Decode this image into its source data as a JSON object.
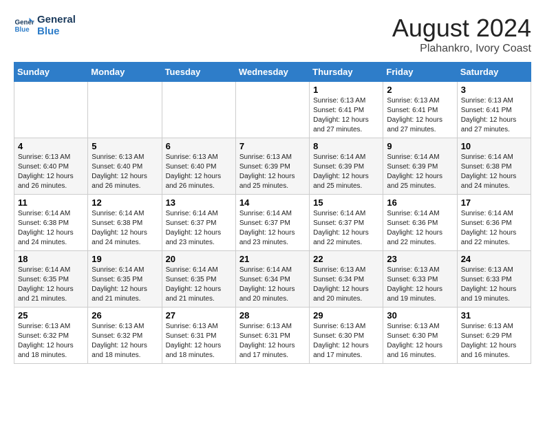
{
  "logo": {
    "line1": "General",
    "line2": "Blue"
  },
  "title": "August 2024",
  "subtitle": "Plahankro, Ivory Coast",
  "days_of_week": [
    "Sunday",
    "Monday",
    "Tuesday",
    "Wednesday",
    "Thursday",
    "Friday",
    "Saturday"
  ],
  "weeks": [
    [
      {
        "day": "",
        "info": ""
      },
      {
        "day": "",
        "info": ""
      },
      {
        "day": "",
        "info": ""
      },
      {
        "day": "",
        "info": ""
      },
      {
        "day": "1",
        "info": "Sunrise: 6:13 AM\nSunset: 6:41 PM\nDaylight: 12 hours\nand 27 minutes."
      },
      {
        "day": "2",
        "info": "Sunrise: 6:13 AM\nSunset: 6:41 PM\nDaylight: 12 hours\nand 27 minutes."
      },
      {
        "day": "3",
        "info": "Sunrise: 6:13 AM\nSunset: 6:41 PM\nDaylight: 12 hours\nand 27 minutes."
      }
    ],
    [
      {
        "day": "4",
        "info": "Sunrise: 6:13 AM\nSunset: 6:40 PM\nDaylight: 12 hours\nand 26 minutes."
      },
      {
        "day": "5",
        "info": "Sunrise: 6:13 AM\nSunset: 6:40 PM\nDaylight: 12 hours\nand 26 minutes."
      },
      {
        "day": "6",
        "info": "Sunrise: 6:13 AM\nSunset: 6:40 PM\nDaylight: 12 hours\nand 26 minutes."
      },
      {
        "day": "7",
        "info": "Sunrise: 6:13 AM\nSunset: 6:39 PM\nDaylight: 12 hours\nand 25 minutes."
      },
      {
        "day": "8",
        "info": "Sunrise: 6:14 AM\nSunset: 6:39 PM\nDaylight: 12 hours\nand 25 minutes."
      },
      {
        "day": "9",
        "info": "Sunrise: 6:14 AM\nSunset: 6:39 PM\nDaylight: 12 hours\nand 25 minutes."
      },
      {
        "day": "10",
        "info": "Sunrise: 6:14 AM\nSunset: 6:38 PM\nDaylight: 12 hours\nand 24 minutes."
      }
    ],
    [
      {
        "day": "11",
        "info": "Sunrise: 6:14 AM\nSunset: 6:38 PM\nDaylight: 12 hours\nand 24 minutes."
      },
      {
        "day": "12",
        "info": "Sunrise: 6:14 AM\nSunset: 6:38 PM\nDaylight: 12 hours\nand 24 minutes."
      },
      {
        "day": "13",
        "info": "Sunrise: 6:14 AM\nSunset: 6:37 PM\nDaylight: 12 hours\nand 23 minutes."
      },
      {
        "day": "14",
        "info": "Sunrise: 6:14 AM\nSunset: 6:37 PM\nDaylight: 12 hours\nand 23 minutes."
      },
      {
        "day": "15",
        "info": "Sunrise: 6:14 AM\nSunset: 6:37 PM\nDaylight: 12 hours\nand 22 minutes."
      },
      {
        "day": "16",
        "info": "Sunrise: 6:14 AM\nSunset: 6:36 PM\nDaylight: 12 hours\nand 22 minutes."
      },
      {
        "day": "17",
        "info": "Sunrise: 6:14 AM\nSunset: 6:36 PM\nDaylight: 12 hours\nand 22 minutes."
      }
    ],
    [
      {
        "day": "18",
        "info": "Sunrise: 6:14 AM\nSunset: 6:35 PM\nDaylight: 12 hours\nand 21 minutes."
      },
      {
        "day": "19",
        "info": "Sunrise: 6:14 AM\nSunset: 6:35 PM\nDaylight: 12 hours\nand 21 minutes."
      },
      {
        "day": "20",
        "info": "Sunrise: 6:14 AM\nSunset: 6:35 PM\nDaylight: 12 hours\nand 21 minutes."
      },
      {
        "day": "21",
        "info": "Sunrise: 6:14 AM\nSunset: 6:34 PM\nDaylight: 12 hours\nand 20 minutes."
      },
      {
        "day": "22",
        "info": "Sunrise: 6:13 AM\nSunset: 6:34 PM\nDaylight: 12 hours\nand 20 minutes."
      },
      {
        "day": "23",
        "info": "Sunrise: 6:13 AM\nSunset: 6:33 PM\nDaylight: 12 hours\nand 19 minutes."
      },
      {
        "day": "24",
        "info": "Sunrise: 6:13 AM\nSunset: 6:33 PM\nDaylight: 12 hours\nand 19 minutes."
      }
    ],
    [
      {
        "day": "25",
        "info": "Sunrise: 6:13 AM\nSunset: 6:32 PM\nDaylight: 12 hours\nand 18 minutes."
      },
      {
        "day": "26",
        "info": "Sunrise: 6:13 AM\nSunset: 6:32 PM\nDaylight: 12 hours\nand 18 minutes."
      },
      {
        "day": "27",
        "info": "Sunrise: 6:13 AM\nSunset: 6:31 PM\nDaylight: 12 hours\nand 18 minutes."
      },
      {
        "day": "28",
        "info": "Sunrise: 6:13 AM\nSunset: 6:31 PM\nDaylight: 12 hours\nand 17 minutes."
      },
      {
        "day": "29",
        "info": "Sunrise: 6:13 AM\nSunset: 6:30 PM\nDaylight: 12 hours\nand 17 minutes."
      },
      {
        "day": "30",
        "info": "Sunrise: 6:13 AM\nSunset: 6:30 PM\nDaylight: 12 hours\nand 16 minutes."
      },
      {
        "day": "31",
        "info": "Sunrise: 6:13 AM\nSunset: 6:29 PM\nDaylight: 12 hours\nand 16 minutes."
      }
    ]
  ]
}
